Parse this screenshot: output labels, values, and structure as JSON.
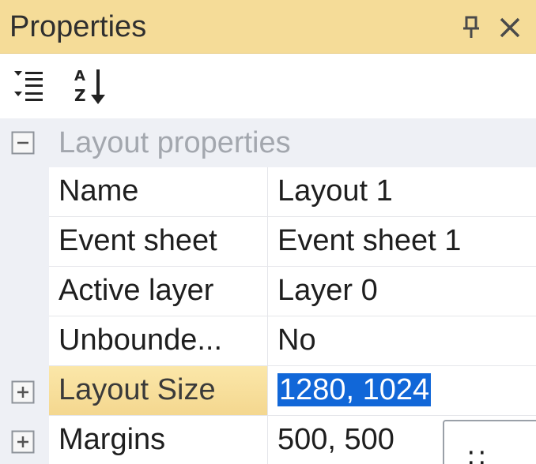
{
  "panel": {
    "title": "Properties",
    "pin_icon": "pin-icon",
    "close_icon": "close-icon"
  },
  "toolbar": {
    "categorized_icon": "categorized-view-icon",
    "alphabetical_icon": "sort-alphabetical-icon"
  },
  "category": {
    "label": "Layout properties",
    "expander": "collapse"
  },
  "properties": [
    {
      "name": "Name",
      "value": "Layout 1"
    },
    {
      "name": "Event sheet",
      "value": "Event sheet 1"
    },
    {
      "name": "Active layer",
      "value": "Layer 0"
    },
    {
      "name": "Unbounde...",
      "value": "No"
    },
    {
      "name": "Layout Size",
      "value": "1280, 1024",
      "expander": "expand",
      "selected": true
    },
    {
      "name": "Margins",
      "value": "500, 500",
      "expander": "expand"
    }
  ],
  "popup": {
    "glyph": "∷"
  },
  "colors": {
    "title_bar": "#f5dc98",
    "selection": "#1167d8",
    "gutter": "#eef0f5",
    "category_text": "#a3a7ae"
  }
}
